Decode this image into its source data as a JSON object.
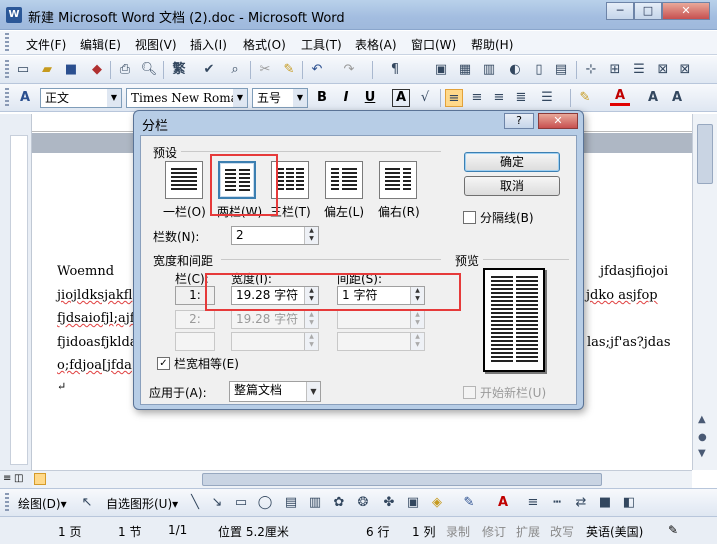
{
  "window": {
    "icon": "word-doc-icon",
    "title": "新建 Microsoft Word 文档 (2).doc - Microsoft Word",
    "min": "─",
    "max": "□",
    "close": "✕"
  },
  "menubar": {
    "items": [
      "文件(F)",
      "编辑(E)",
      "视图(V)",
      "插入(I)",
      "格式(O)",
      "工具(T)",
      "表格(A)",
      "窗口(W)",
      "帮助(H)"
    ]
  },
  "toolbar": {
    "view_button": "繁"
  },
  "format_toolbar": {
    "style": "正文",
    "font": "Times New Roman",
    "size": "五号",
    "bold": "B",
    "italic": "I",
    "underline": "U",
    "char_border": "A",
    "font_color": "A"
  },
  "document": {
    "lines": [
      {
        "left": "Woemnd",
        "right": "jfdasjfiojoi"
      },
      {
        "left": "jiojldksjakfl",
        "right": "jdko   asjfop"
      },
      {
        "left": "fjdsaiofjl;ajf",
        "right": ""
      },
      {
        "left": "fjidoasfjklda",
        "right": "las;jf'as?jdas"
      },
      {
        "left": "o;fdjoa[jfda",
        "right": ""
      }
    ],
    "cursor_mark": "↵"
  },
  "dialog": {
    "title": "分栏",
    "help": "?",
    "close": "✕",
    "presets_label": "预设",
    "presets": [
      "一栏(O)",
      "两栏(W)",
      "三栏(T)",
      "偏左(L)",
      "偏右(R)"
    ],
    "ok": "确定",
    "cancel": "取消",
    "separator_label": "分隔线(B)",
    "columns_label": "栏数(N):",
    "columns_value": "2",
    "width_spacing_label": "宽度和间距",
    "col_header": "栏(C):",
    "width_header": "宽度(I):",
    "spacing_header": "间距(S):",
    "rows": [
      {
        "num": "1:",
        "width": "19.28 字符",
        "spacing": "1 字符"
      },
      {
        "num": "2:",
        "width": "19.28 字符",
        "spacing": ""
      },
      {
        "num": "",
        "width": "",
        "spacing": ""
      }
    ],
    "equal_width_label": "栏宽相等(E)",
    "equal_width_checked": "✓",
    "preview_label": "预览",
    "apply_label": "应用于(A):",
    "apply_value": "整篇文档",
    "new_column_label": "开始新栏(U)"
  },
  "drawbar": {
    "draw": "绘图(D)▾",
    "autoshapes": "自选图形(U)▾"
  },
  "status": {
    "page": "1 页",
    "section": "1 节",
    "pages": "1/1",
    "position": "位置 5.2厘米",
    "line": "6 行",
    "col": "1 列",
    "rec": "录制",
    "trk": "修订",
    "ext": "扩展",
    "ovr": "改写",
    "lang": "英语(美国)"
  }
}
